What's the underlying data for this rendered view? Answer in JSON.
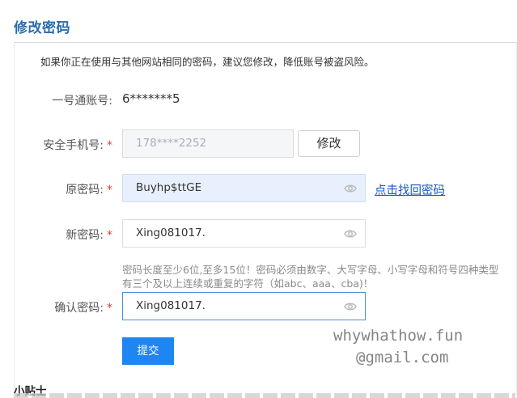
{
  "page": {
    "title": "修改密码",
    "notice": "如果你正在使用与其他网站相同的密码，建议您修改，降低账号被盗风险。"
  },
  "form": {
    "account": {
      "label": "一号通账号:",
      "value": "6*******5"
    },
    "phone": {
      "label": "安全手机号:",
      "required_mark": "*",
      "value": "178****2252",
      "modify_label": "修改"
    },
    "old_password": {
      "label": "原密码:",
      "required_mark": "*",
      "value": "Buyhp$ttGE",
      "forgot_link": "点击找回密码",
      "eye_icon": "eye-icon"
    },
    "new_password": {
      "label": "新密码:",
      "required_mark": "*",
      "value": "Xing081017.",
      "eye_icon": "eye-icon"
    },
    "hint_line1": "密码长度至少6位,至多15位！密码必须由数字、大写字母、小写字母和符号四种类型",
    "hint_line2": "有三个及以上连续或重复的字符（如abc、aaa、cba)！",
    "confirm_password": {
      "label": "确认密码:",
      "required_mark": "*",
      "value": "Xing081017.",
      "eye_icon": "eye-icon"
    },
    "submit_label": "提交"
  },
  "tips": {
    "title": "小贴士"
  },
  "watermark": {
    "line1": "whywhathow.fun",
    "line2": "@gmail.com"
  },
  "colors": {
    "title": "#2b6cb0",
    "required": "#e53e3e",
    "link": "#1a56c8",
    "submit_bg": "#1e86f2",
    "focus_border": "#4a90d9"
  }
}
